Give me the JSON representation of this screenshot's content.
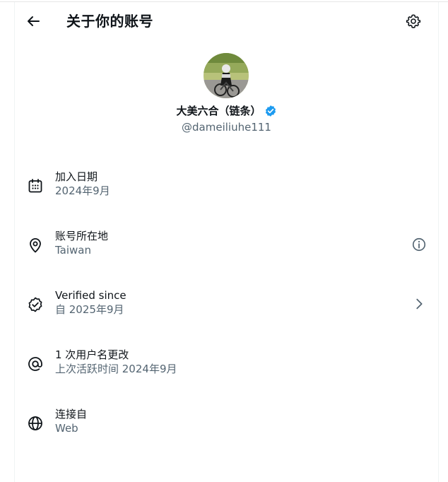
{
  "header": {
    "title": "关于你的账号",
    "back_icon": "arrow-left-icon",
    "settings_icon": "gear-icon"
  },
  "profile": {
    "display_name": "大美六合（链条）",
    "handle": "@dameiliuhe111",
    "verified_icon": "verified-badge-icon",
    "verified_color": "#1d9bf0"
  },
  "details": [
    {
      "label": "加入日期",
      "value": "2024年9月",
      "icon": "calendar-icon"
    },
    {
      "label": "账号所在地",
      "value": "Taiwan",
      "icon": "location-pin-icon",
      "trailing_icon": "info-icon"
    },
    {
      "label": "Verified since",
      "value": "自 2025年9月",
      "icon": "verified-check-icon",
      "trailing_icon": "chevron-right-icon"
    },
    {
      "label": "1 次用户名更改",
      "value": "上次活跃时间 2024年9月",
      "icon": "at-sign-icon"
    },
    {
      "label": "连接自",
      "value": "Web",
      "icon": "globe-icon"
    }
  ],
  "colors": {
    "text": "#0f1419",
    "secondary_text": "#536471",
    "accent": "#1d9bf0"
  }
}
